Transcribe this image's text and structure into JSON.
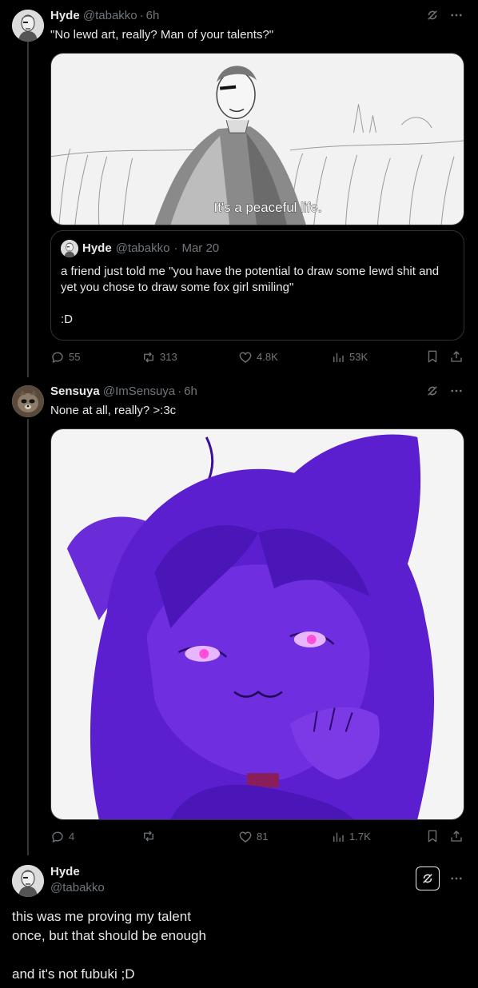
{
  "posts": [
    {
      "author": "Hyde",
      "handle": "@tabakko",
      "time": "6h",
      "text": "\"No lewd art, really? Man of your talents?\"",
      "media_caption": "It's a peaceful life.",
      "quote": {
        "author": "Hyde",
        "handle": "@tabakko",
        "time": "Mar 20",
        "text_line1": "a friend just told me \"you have the potential to draw some lewd shit and yet you chose to draw some fox girl smiling\"",
        "text_line2": ":D"
      },
      "actions": {
        "replies": "55",
        "reposts": "313",
        "likes": "4.8K",
        "views": "53K"
      }
    },
    {
      "author": "Sensuya",
      "handle": "@ImSensuya",
      "time": "6h",
      "text": "None at all, really? >:3c",
      "actions": {
        "replies": "4",
        "reposts": "",
        "likes": "81",
        "views": "1.7K"
      }
    },
    {
      "author": "Hyde",
      "handle": "@tabakko",
      "text_line1": "this was me proving my talent",
      "text_line2": "once, but that should be enough",
      "text_line3": "and it's not fubuki ;D"
    }
  ],
  "icons": {
    "grok": "grok-icon",
    "more": "more-icon",
    "reply": "reply-icon",
    "repost": "repost-icon",
    "like": "like-icon",
    "views": "views-icon",
    "bookmark": "bookmark-icon",
    "share": "share-icon"
  },
  "colors": {
    "background": "#000000",
    "text": "#e7e9ea",
    "secondary": "#71767b",
    "border": "#2f3336",
    "anime_purple": "#5b1fd0"
  }
}
